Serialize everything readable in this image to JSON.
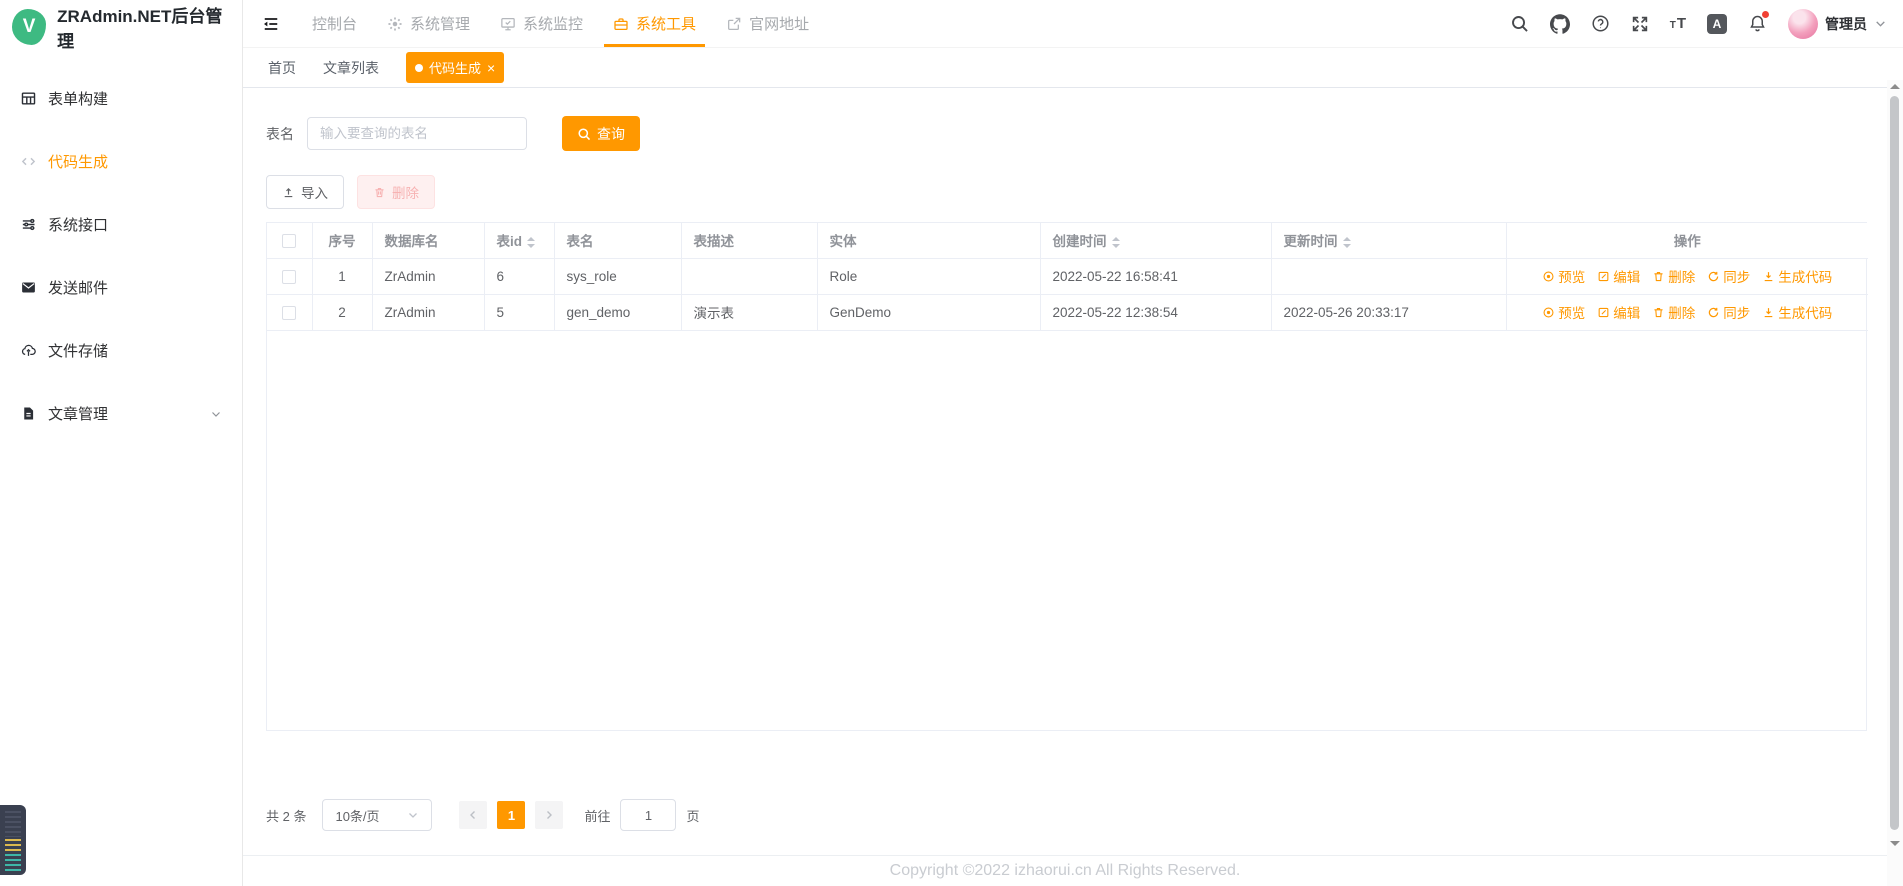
{
  "app": {
    "title": "ZRAdmin.NET后台管理",
    "logo_letter": "V",
    "accent_color": "#ff9800",
    "logo_color": "#3eba82"
  },
  "sidebar": {
    "items": [
      {
        "label": "表单构建",
        "icon": "form-grid-icon"
      },
      {
        "label": "代码生成",
        "icon": "code-icon",
        "active": true
      },
      {
        "label": "系统接口",
        "icon": "sliders-icon"
      },
      {
        "label": "发送邮件",
        "icon": "mail-icon"
      },
      {
        "label": "文件存储",
        "icon": "cloud-upload-icon"
      },
      {
        "label": "文章管理",
        "icon": "document-icon",
        "expandable": true
      }
    ]
  },
  "topnav": {
    "items": [
      {
        "label": "控制台",
        "icon": ""
      },
      {
        "label": "系统管理",
        "icon": "gear-icon"
      },
      {
        "label": "系统监控",
        "icon": "monitor-icon"
      },
      {
        "label": "系统工具",
        "icon": "toolbox-icon",
        "active": true
      },
      {
        "label": "官网地址",
        "icon": "external-link-icon"
      }
    ]
  },
  "userbar": {
    "username": "管理员",
    "icons": [
      "search-icon",
      "github-icon",
      "help-icon",
      "fullscreen-icon",
      "font-size-icon",
      "translate-icon",
      "bell-icon"
    ],
    "translate_letter": "A",
    "font_size_glyph_small": "T",
    "font_size_glyph_large": "T",
    "bell_has_red_dot": true
  },
  "tabs": [
    {
      "label": "首页"
    },
    {
      "label": "文章列表"
    },
    {
      "label": "代码生成",
      "active": true,
      "closable": true,
      "close_glyph": "×"
    }
  ],
  "filter": {
    "label": "表名",
    "placeholder": "输入要查询的表名",
    "search_button": "查询"
  },
  "toolbar": {
    "import_button": "导入",
    "delete_button": "删除"
  },
  "table": {
    "columns": [
      "序号",
      "数据库名",
      "表id",
      "表名",
      "表描述",
      "实体",
      "创建时间",
      "更新时间",
      "操作"
    ],
    "sortable_columns": [
      "表id",
      "创建时间",
      "更新时间"
    ],
    "rows": [
      {
        "seq": "1",
        "db_name": "ZrAdmin",
        "table_id": "6",
        "table_name": "sys_role",
        "description": "",
        "entity": "Role",
        "created_at": "2022-05-22 16:58:41",
        "updated_at": ""
      },
      {
        "seq": "2",
        "db_name": "ZrAdmin",
        "table_id": "5",
        "table_name": "gen_demo",
        "description": "演示表",
        "entity": "GenDemo",
        "created_at": "2022-05-22 12:38:54",
        "updated_at": "2022-05-26 20:33:17"
      }
    ],
    "actions": [
      {
        "label": "预览",
        "icon": "eye-icon"
      },
      {
        "label": "编辑",
        "icon": "edit-icon"
      },
      {
        "label": "删除",
        "icon": "trash-icon"
      },
      {
        "label": "同步",
        "icon": "sync-icon"
      },
      {
        "label": "生成代码",
        "icon": "download-icon"
      }
    ]
  },
  "pagination": {
    "total_text": "共 2 条",
    "page_size": "10条/页",
    "current_page": "1",
    "goto_label": "前往",
    "goto_value": "1",
    "unit_label": "页"
  },
  "footer": {
    "copyright": "Copyright ©2022 izhaorui.cn All Rights Reserved."
  }
}
